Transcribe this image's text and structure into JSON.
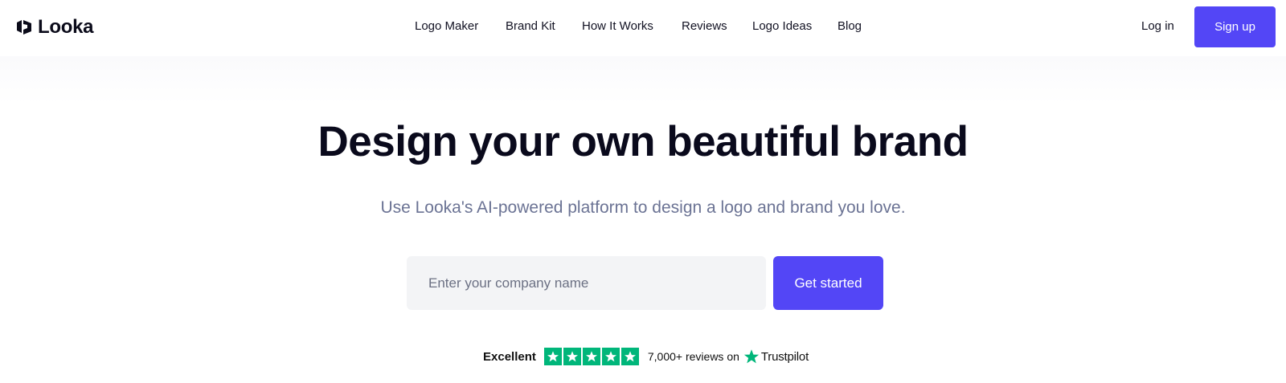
{
  "header": {
    "brand": "Looka",
    "nav": [
      {
        "label": "Logo Maker"
      },
      {
        "label": "Brand Kit"
      },
      {
        "label": "How It Works"
      },
      {
        "label": "Reviews"
      },
      {
        "label": "Logo Ideas"
      },
      {
        "label": "Blog"
      }
    ],
    "login_label": "Log in",
    "signup_label": "Sign up"
  },
  "hero": {
    "headline": "Design your own beautiful brand",
    "subhead": "Use Looka's AI-powered platform to design a logo and brand you love.",
    "input_placeholder": "Enter your company name",
    "input_value": "",
    "cta_label": "Get started"
  },
  "trust": {
    "rating_label": "Excellent",
    "stars_filled": 5,
    "stars_total": 5,
    "reviews_text": "7,000+ reviews on",
    "provider": "Trustpilot",
    "star_color": "#00b67a"
  },
  "theme": {
    "accent": "#5346f6",
    "subtext": "#6b7394",
    "input_bg": "#f3f4f6"
  },
  "icons": {
    "brand_mark": "looka-logo-icon",
    "rating_star": "star-icon",
    "provider_star": "trustpilot-star-icon"
  }
}
